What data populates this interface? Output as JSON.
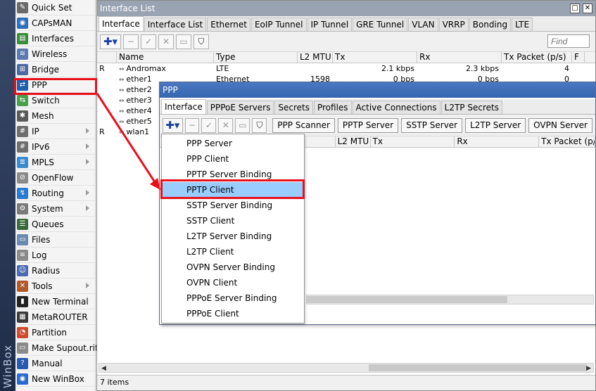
{
  "brand": "WinBox",
  "side_menu": [
    {
      "label": "Quick Set",
      "icon": "quick-set-icon",
      "color": "#6a6a6a",
      "glyph": "✎",
      "arrow": false
    },
    {
      "label": "CAPsMAN",
      "icon": "capsman-icon",
      "color": "#2e6fb8",
      "glyph": "◉",
      "arrow": false
    },
    {
      "label": "Interfaces",
      "icon": "interfaces-icon",
      "color": "#3a8a3a",
      "glyph": "▤",
      "arrow": false
    },
    {
      "label": "Wireless",
      "icon": "wireless-icon",
      "color": "#5a7ab0",
      "glyph": "≋",
      "arrow": false
    },
    {
      "label": "Bridge",
      "icon": "bridge-icon",
      "color": "#4a6aa0",
      "glyph": "⊞",
      "arrow": false
    },
    {
      "label": "PPP",
      "icon": "ppp-icon",
      "color": "#1f5fb0",
      "glyph": "⇄",
      "arrow": false
    },
    {
      "label": "Switch",
      "icon": "switch-icon",
      "color": "#4aa04a",
      "glyph": "⇆",
      "arrow": false
    },
    {
      "label": "Mesh",
      "icon": "mesh-icon",
      "color": "#5a5a5a",
      "glyph": "✱",
      "arrow": false
    },
    {
      "label": "IP",
      "icon": "ip-icon",
      "color": "#6e6e6e",
      "glyph": "#",
      "arrow": true
    },
    {
      "label": "IPv6",
      "icon": "ipv6-icon",
      "color": "#6e6e6e",
      "glyph": "#",
      "arrow": true
    },
    {
      "label": "MPLS",
      "icon": "mpls-icon",
      "color": "#3a8ad0",
      "glyph": "≣",
      "arrow": true
    },
    {
      "label": "OpenFlow",
      "icon": "openflow-icon",
      "color": "#8a8a8a",
      "glyph": "⊘",
      "arrow": false
    },
    {
      "label": "Routing",
      "icon": "routing-icon",
      "color": "#2a7ad0",
      "glyph": "↯",
      "arrow": true
    },
    {
      "label": "System",
      "icon": "system-icon",
      "color": "#7a7a7a",
      "glyph": "⚙",
      "arrow": true
    },
    {
      "label": "Queues",
      "icon": "queues-icon",
      "color": "#3a6a3a",
      "glyph": "☰",
      "arrow": false
    },
    {
      "label": "Files",
      "icon": "files-icon",
      "color": "#6a8ab0",
      "glyph": "▭",
      "arrow": false
    },
    {
      "label": "Log",
      "icon": "log-icon",
      "color": "#8a8a8a",
      "glyph": "≡",
      "arrow": false
    },
    {
      "label": "Radius",
      "icon": "radius-icon",
      "color": "#4a6ab0",
      "glyph": "☺",
      "arrow": false
    },
    {
      "label": "Tools",
      "icon": "tools-icon",
      "color": "#b05a2a",
      "glyph": "✕",
      "arrow": true
    },
    {
      "label": "New Terminal",
      "icon": "terminal-icon",
      "color": "#222222",
      "glyph": "▮",
      "arrow": false
    },
    {
      "label": "MetaROUTER",
      "icon": "metarouter-icon",
      "color": "#3a3a3a",
      "glyph": "▦",
      "arrow": false
    },
    {
      "label": "Partition",
      "icon": "partition-icon",
      "color": "#d04a2a",
      "glyph": "◔",
      "arrow": false
    },
    {
      "label": "Make Supout.rif",
      "icon": "supout-icon",
      "color": "#8a8a8a",
      "glyph": "▭",
      "arrow": false
    },
    {
      "label": "Manual",
      "icon": "manual-icon",
      "color": "#2a5ab0",
      "glyph": "?",
      "arrow": false
    },
    {
      "label": "New WinBox",
      "icon": "new-winbox-icon",
      "color": "#2a6ad0",
      "glyph": "◉",
      "arrow": false
    }
  ],
  "iface_window": {
    "title": "Interface List",
    "tabs": [
      "Interface",
      "Interface List",
      "Ethernet",
      "EoIP Tunnel",
      "IP Tunnel",
      "GRE Tunnel",
      "VLAN",
      "VRRP",
      "Bonding",
      "LTE"
    ],
    "find_placeholder": "Find",
    "columns": [
      "",
      "Name",
      "Type",
      "L2 MTU",
      "Tx",
      "Rx",
      "Tx Packet (p/s)",
      "F"
    ],
    "rows": [
      {
        "flag": "R",
        "name": "Andromax",
        "type": "LTE",
        "l2mtu": "",
        "tx": "2.1 kbps",
        "rx": "2.3 kbps",
        "txp": "4"
      },
      {
        "flag": "",
        "name": "ether1",
        "type": "Ethernet",
        "l2mtu": "1598",
        "tx": "0 bps",
        "rx": "0 bps",
        "txp": "0"
      },
      {
        "flag": "",
        "name": "ether2",
        "type": "",
        "l2mtu": "",
        "tx": "",
        "rx": "",
        "txp": ""
      },
      {
        "flag": "",
        "name": "ether3",
        "type": "",
        "l2mtu": "",
        "tx": "",
        "rx": "",
        "txp": ""
      },
      {
        "flag": "",
        "name": "ether4",
        "type": "",
        "l2mtu": "",
        "tx": "",
        "rx": "",
        "txp": ""
      },
      {
        "flag": "",
        "name": "ether5",
        "type": "",
        "l2mtu": "",
        "tx": "",
        "rx": "",
        "txp": ""
      },
      {
        "flag": "R",
        "name": "wlan1",
        "type": "",
        "l2mtu": "",
        "tx": "",
        "rx": "",
        "txp": ""
      }
    ],
    "status": "7 items"
  },
  "ppp_window": {
    "title": "PPP",
    "tabs": [
      "Interface",
      "PPPoE Servers",
      "Secrets",
      "Profiles",
      "Active Connections",
      "L2TP Secrets"
    ],
    "buttons": [
      "PPP Scanner",
      "PPTP Server",
      "SSTP Server",
      "L2TP Server",
      "OVPN Server"
    ],
    "columns": [
      "L2 MTU",
      "Tx",
      "Rx",
      "Tx Packet (p/s)"
    ]
  },
  "dropdown": {
    "items": [
      "PPP Server",
      "PPP Client",
      "PPTP Server Binding",
      "PPTP Client",
      "SSTP Server Binding",
      "SSTP Client",
      "L2TP Server Binding",
      "L2TP Client",
      "OVPN Server Binding",
      "OVPN Client",
      "PPPoE Server Binding",
      "PPPoE Client"
    ],
    "selected_index": 3
  },
  "colors": {
    "highlight": "#e8101a",
    "selected": "#99ccff",
    "titlebar_active": "#3566b0"
  }
}
